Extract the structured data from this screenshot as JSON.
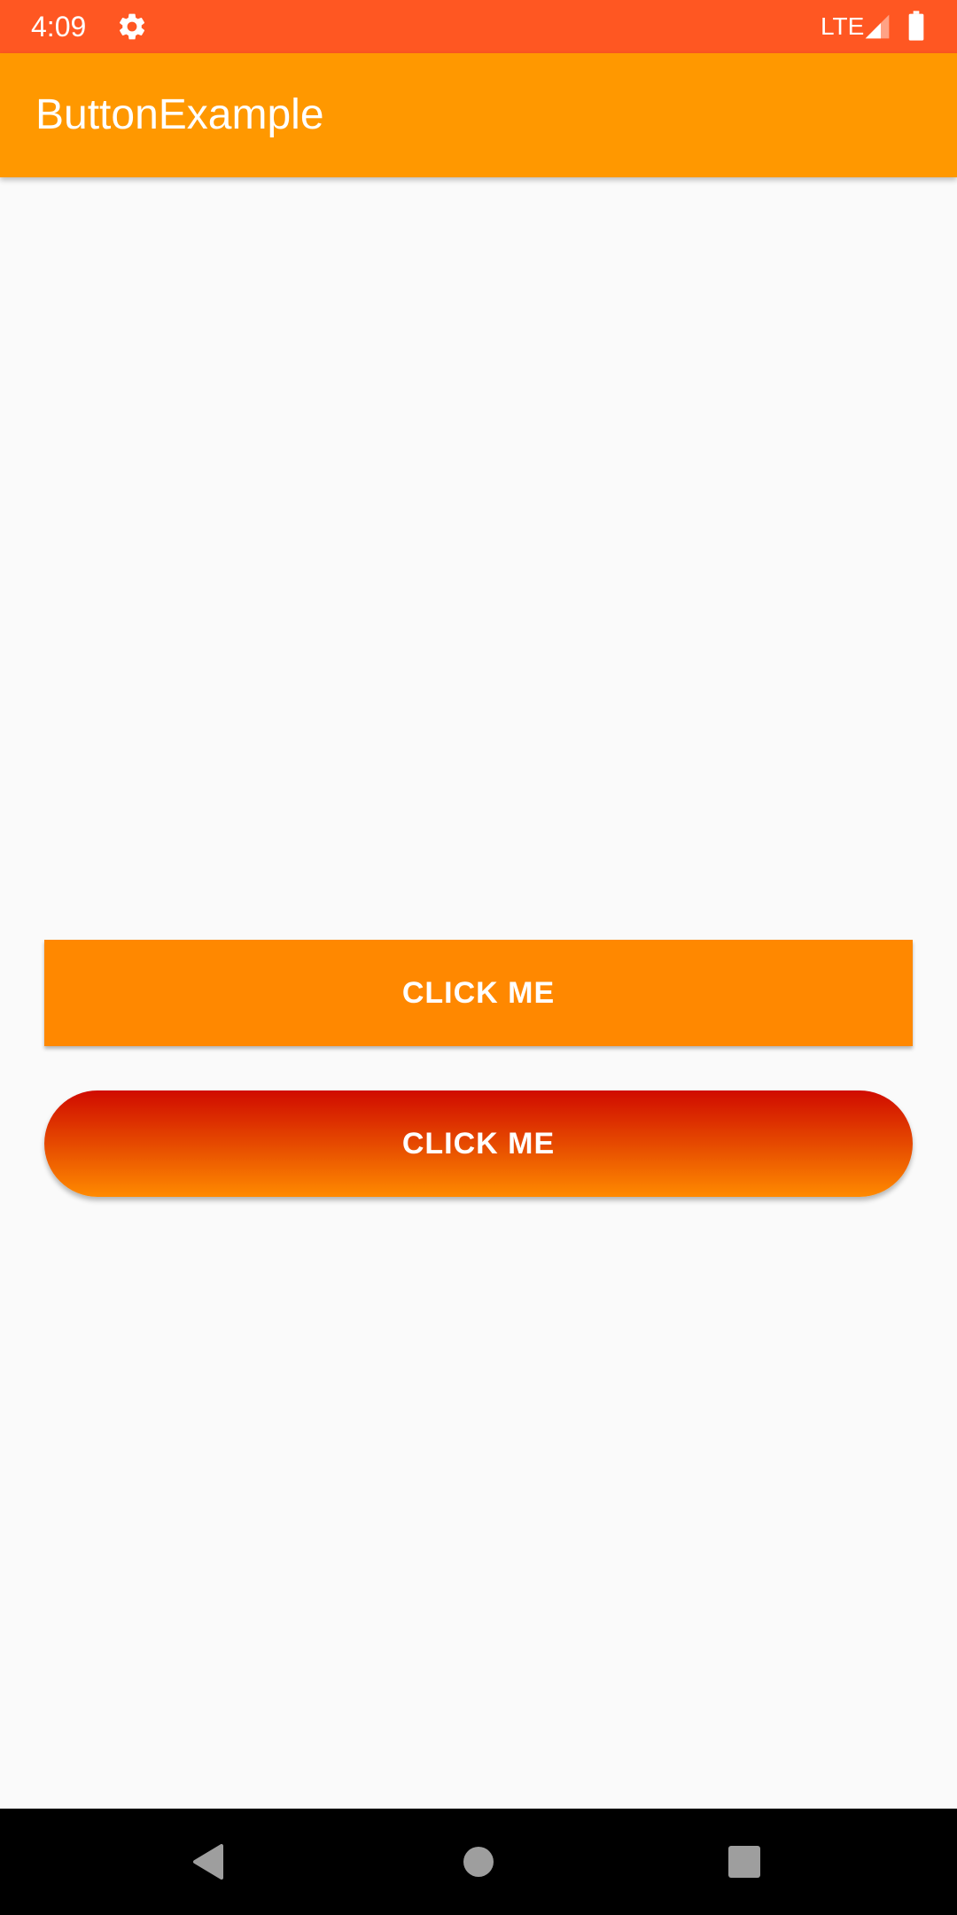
{
  "status_bar": {
    "time": "4:09",
    "network": "LTE",
    "background_color": "#ff5722",
    "icons": [
      "gear-icon",
      "signal-icon",
      "battery-icon"
    ]
  },
  "app_bar": {
    "title": "ButtonExample",
    "background_color": "#ff9800"
  },
  "buttons": [
    {
      "label": "CLICK ME",
      "style": "flat",
      "color": "#ff8800"
    },
    {
      "label": "CLICK ME",
      "style": "pill-gradient",
      "gradient_colors": [
        "#d00b00",
        "#ff8a00"
      ]
    }
  ],
  "navigation_bar": {
    "icons": [
      "back-icon",
      "home-icon",
      "recents-icon"
    ]
  }
}
